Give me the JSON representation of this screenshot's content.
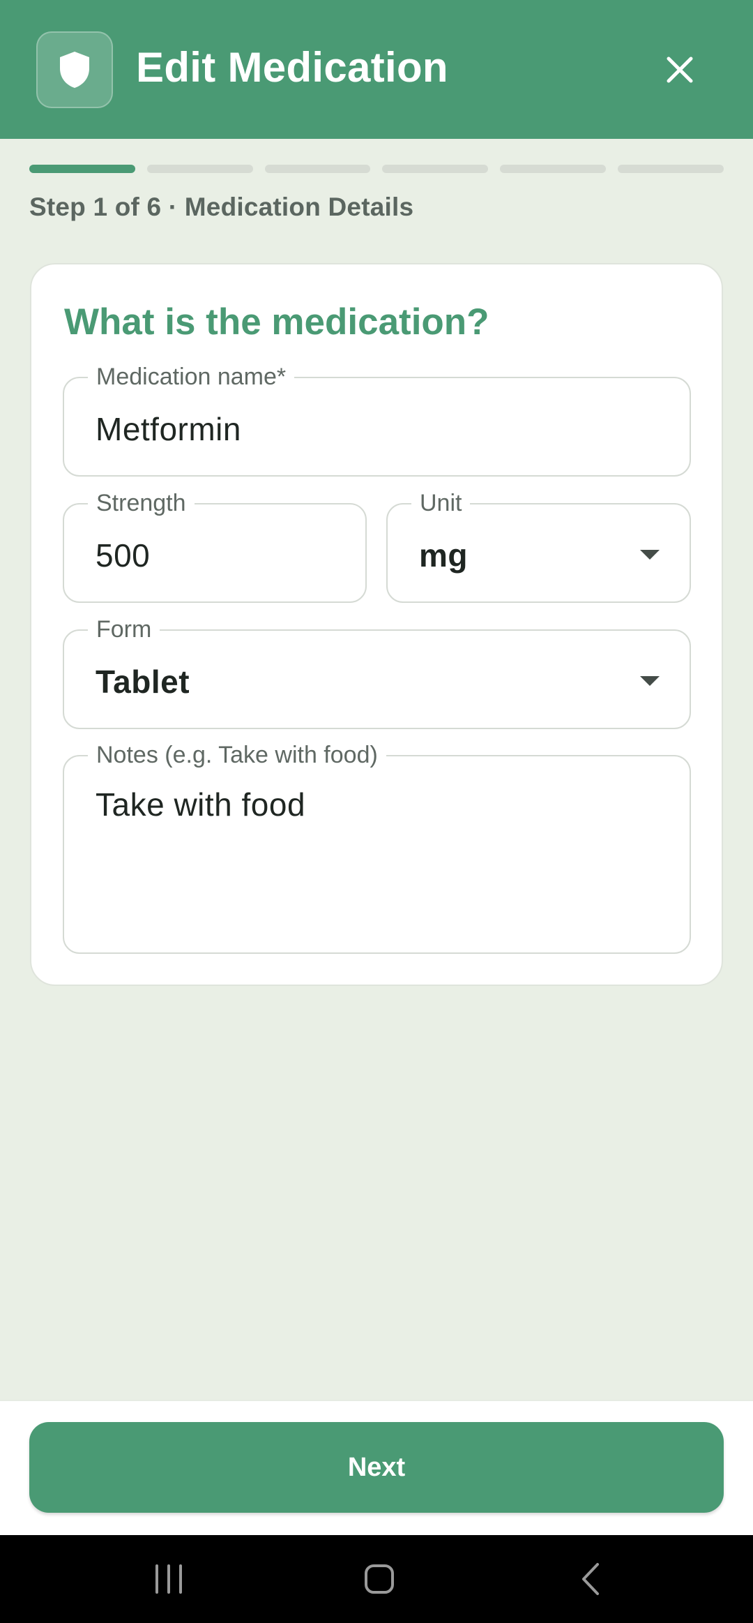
{
  "app_bar": {
    "title": "Edit Medication",
    "icon": "shield-icon",
    "close_icon": "close-icon"
  },
  "progress": {
    "total_steps": 6,
    "current_step": 1,
    "label": "Step 1 of 6 · Medication Details"
  },
  "form": {
    "heading": "What is the medication?",
    "medication_name": {
      "label": "Medication name*",
      "value": "Metformin"
    },
    "strength": {
      "label": "Strength",
      "value": "500"
    },
    "unit": {
      "label": "Unit",
      "value": "mg"
    },
    "form_type": {
      "label": "Form",
      "value": "Tablet"
    },
    "notes": {
      "label": "Notes (e.g. Take with food)",
      "value": "Take with food"
    }
  },
  "footer": {
    "next_label": "Next"
  },
  "system_nav": {
    "recents_icon": "recents-icon",
    "home_icon": "home-icon",
    "back_icon": "back-icon"
  },
  "colors": {
    "primary": "#4a9a74",
    "background": "#e9efe5",
    "progress_inactive": "#d6dbd3"
  }
}
